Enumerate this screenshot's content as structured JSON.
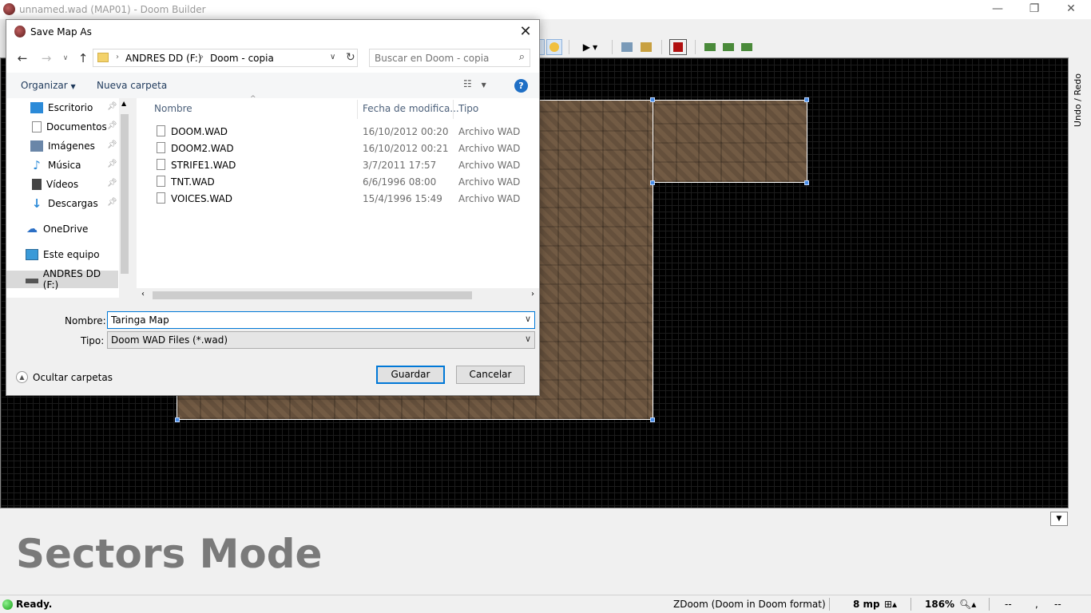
{
  "app": {
    "title": "unnamed.wad (MAP01) - Doom Builder",
    "window_controls": {
      "minimize": "—",
      "restore": "❐",
      "close": "✕"
    }
  },
  "canvas": {
    "right_panel_label": "Undo / Redo"
  },
  "info_panel": {
    "mode_title": "Sectors Mode"
  },
  "status_bar": {
    "status": "Ready.",
    "game_config": "ZDoom (Doom in Doom format)",
    "grid": "8 mp",
    "zoom": "186%",
    "coord_x": "--",
    "coord_sep": ",",
    "coord_y": "--"
  },
  "dialog": {
    "title": "Save Map As",
    "breadcrumb": [
      "ANDRES DD (F:)",
      "Doom - copia"
    ],
    "search_placeholder": "Buscar en Doom - copia",
    "organize_label": "Organizar",
    "new_folder_label": "Nueva carpeta",
    "nav_items": [
      {
        "label": "Escritorio",
        "pinned": true
      },
      {
        "label": "Documentos",
        "pinned": true
      },
      {
        "label": "Imágenes",
        "pinned": true
      },
      {
        "label": "Música",
        "pinned": true
      },
      {
        "label": "Vídeos",
        "pinned": true
      },
      {
        "label": "Descargas",
        "pinned": true
      },
      {
        "label": "OneDrive",
        "pinned": false
      },
      {
        "label": "Este equipo",
        "pinned": false
      },
      {
        "label": "ANDRES DD (F:)",
        "pinned": false,
        "selected": true
      }
    ],
    "columns": {
      "name": "Nombre",
      "date": "Fecha de modifica...",
      "type": "Tipo"
    },
    "files": [
      {
        "name": "DOOM.WAD",
        "date": "16/10/2012 00:20",
        "type": "Archivo WAD"
      },
      {
        "name": "DOOM2.WAD",
        "date": "16/10/2012 00:21",
        "type": "Archivo WAD"
      },
      {
        "name": "STRIFE1.WAD",
        "date": "3/7/2011 17:57",
        "type": "Archivo WAD"
      },
      {
        "name": "TNT.WAD",
        "date": "6/6/1996 08:00",
        "type": "Archivo WAD"
      },
      {
        "name": "VOICES.WAD",
        "date": "15/4/1996 15:49",
        "type": "Archivo WAD"
      }
    ],
    "filename_label": "Nombre:",
    "filename_value": "Taringa Map",
    "filetype_label": "Tipo:",
    "filetype_value": "Doom WAD Files (*.wad)",
    "hide_folders_label": "Ocultar carpetas",
    "save_label": "Guardar",
    "cancel_label": "Cancelar"
  }
}
